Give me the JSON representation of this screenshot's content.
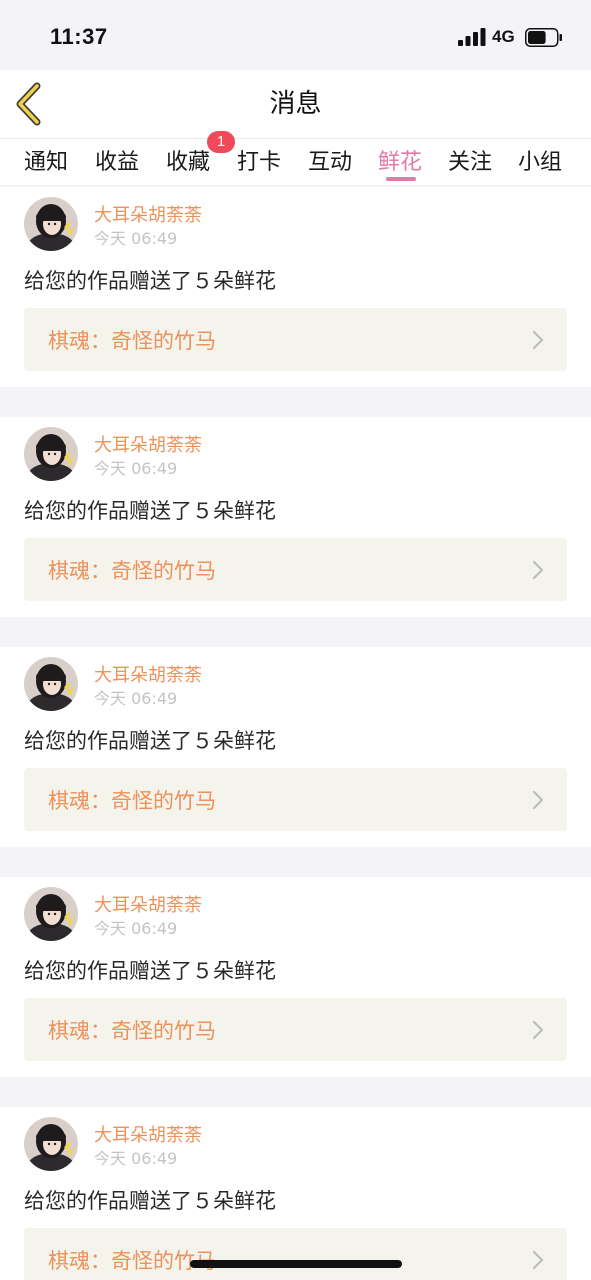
{
  "status_bar": {
    "time": "11:37",
    "network": "4G",
    "battery_level": 0.65
  },
  "nav": {
    "title": "消息",
    "back_icon": "chevron-left-icon"
  },
  "colors": {
    "accent": "#e27aa8",
    "name_orange": "#ee915a",
    "badge_red": "#f04a5a",
    "back_icon": "#e8c44a"
  },
  "tabs": [
    {
      "label": "通知",
      "active": false
    },
    {
      "label": "收益",
      "active": false
    },
    {
      "label": "收藏",
      "active": false,
      "badge": "1"
    },
    {
      "label": "打卡",
      "active": false
    },
    {
      "label": "互动",
      "active": false
    },
    {
      "label": "鲜花",
      "active": true
    },
    {
      "label": "关注",
      "active": false
    },
    {
      "label": "小组",
      "active": false
    }
  ],
  "messages": [
    {
      "user": "大耳朵胡荼荼",
      "time": "今天 06:49",
      "text": "给您的作品赠送了５朵鲜花",
      "work": "棋魂：奇怪的竹马"
    },
    {
      "user": "大耳朵胡荼荼",
      "time": "今天 06:49",
      "text": "给您的作品赠送了５朵鲜花",
      "work": "棋魂：奇怪的竹马"
    },
    {
      "user": "大耳朵胡荼荼",
      "time": "今天 06:49",
      "text": "给您的作品赠送了５朵鲜花",
      "work": "棋魂：奇怪的竹马"
    },
    {
      "user": "大耳朵胡荼荼",
      "time": "今天 06:49",
      "text": "给您的作品赠送了５朵鲜花",
      "work": "棋魂：奇怪的竹马"
    },
    {
      "user": "大耳朵胡荼荼",
      "time": "今天 06:49",
      "text": "给您的作品赠送了５朵鲜花",
      "work": "棋魂：奇怪的竹马"
    }
  ]
}
